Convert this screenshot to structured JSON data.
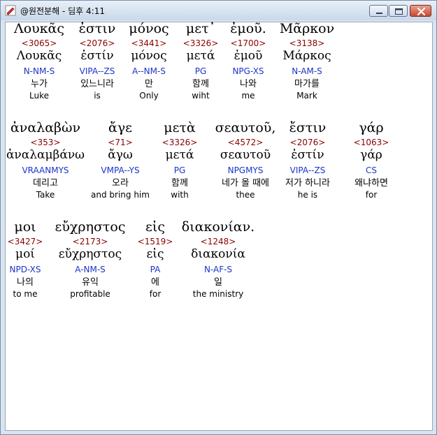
{
  "window": {
    "title": "@원전분해 - 딤후 4:11",
    "icon": "app-pen-icon"
  },
  "rows": [
    {
      "words": [
        {
          "greek": "Λουκᾶς",
          "strong": "<3065>",
          "lemma": "Λουκᾶς",
          "morph": "N-NM-S",
          "korean": "누가",
          "english": "Luke"
        },
        {
          "greek": "ἐστιν",
          "strong": "<2076>",
          "lemma": "ἐστίν",
          "morph": "VIPA--ZS",
          "korean": "있느니라",
          "english": "is"
        },
        {
          "greek": "μόνος",
          "strong": "<3441>",
          "lemma": "μόνος",
          "morph": "A--NM-S",
          "korean": "만",
          "english": "Only"
        },
        {
          "greek": "μετ᾽",
          "strong": "<3326>",
          "lemma": "μετά",
          "morph": "PG",
          "korean": "함께",
          "english": "wiht"
        },
        {
          "greek": "ἐμοῦ.",
          "strong": "<1700>",
          "lemma": "ἐμοῦ",
          "morph": "NPG-XS",
          "korean": "나와",
          "english": "me"
        },
        {
          "greek": "Μᾶρκον",
          "strong": "<3138>",
          "lemma": "Μάρκος",
          "morph": "N-AM-S",
          "korean": "마가를",
          "english": "Mark"
        }
      ]
    },
    {
      "words": [
        {
          "greek": "ἀναλαβὼν",
          "strong": "<353>",
          "lemma": "ἀναλαμβάνω",
          "morph": "VRAANMYS",
          "korean": "데리고",
          "english": "Take"
        },
        {
          "greek": "ἄγε",
          "strong": "<71>",
          "lemma": "ἄγω",
          "morph": "VMPA--YS",
          "korean": "오라",
          "english": "and bring him"
        },
        {
          "greek": "μετὰ",
          "strong": "<3326>",
          "lemma": "μετά",
          "morph": "PG",
          "korean": "함께",
          "english": "with"
        },
        {
          "greek": "σεαυτοῦ,",
          "strong": "<4572>",
          "lemma": "σεαυτοῦ",
          "morph": "NPGMYS",
          "korean": "네가 올 때에",
          "english": "thee"
        },
        {
          "greek": "ἔστιν",
          "strong": "<2076>",
          "lemma": "ἐστίν",
          "morph": "VIPA--ZS",
          "korean": "저가 하니라",
          "english": "he is"
        },
        {
          "greek": "γάρ",
          "strong": "<1063>",
          "lemma": "γάρ",
          "morph": "CS",
          "korean": "왜냐하면",
          "english": "for"
        }
      ]
    },
    {
      "words": [
        {
          "greek": "μοι",
          "strong": "<3427>",
          "lemma": "μοί",
          "morph": "NPD-XS",
          "korean": "나의",
          "english": "to me"
        },
        {
          "greek": "εὔχρηστος",
          "strong": "<2173>",
          "lemma": "εὔχρηστος",
          "morph": "A-NM-S",
          "korean": "유익",
          "english": "profitable"
        },
        {
          "greek": "εἰς",
          "strong": "<1519>",
          "lemma": "εἰς",
          "morph": "PA",
          "korean": "에",
          "english": "for"
        },
        {
          "greek": "διακονίαν.",
          "strong": "<1248>",
          "lemma": "διακονία",
          "morph": "N-AF-S",
          "korean": "일",
          "english": "the ministry"
        }
      ]
    }
  ]
}
